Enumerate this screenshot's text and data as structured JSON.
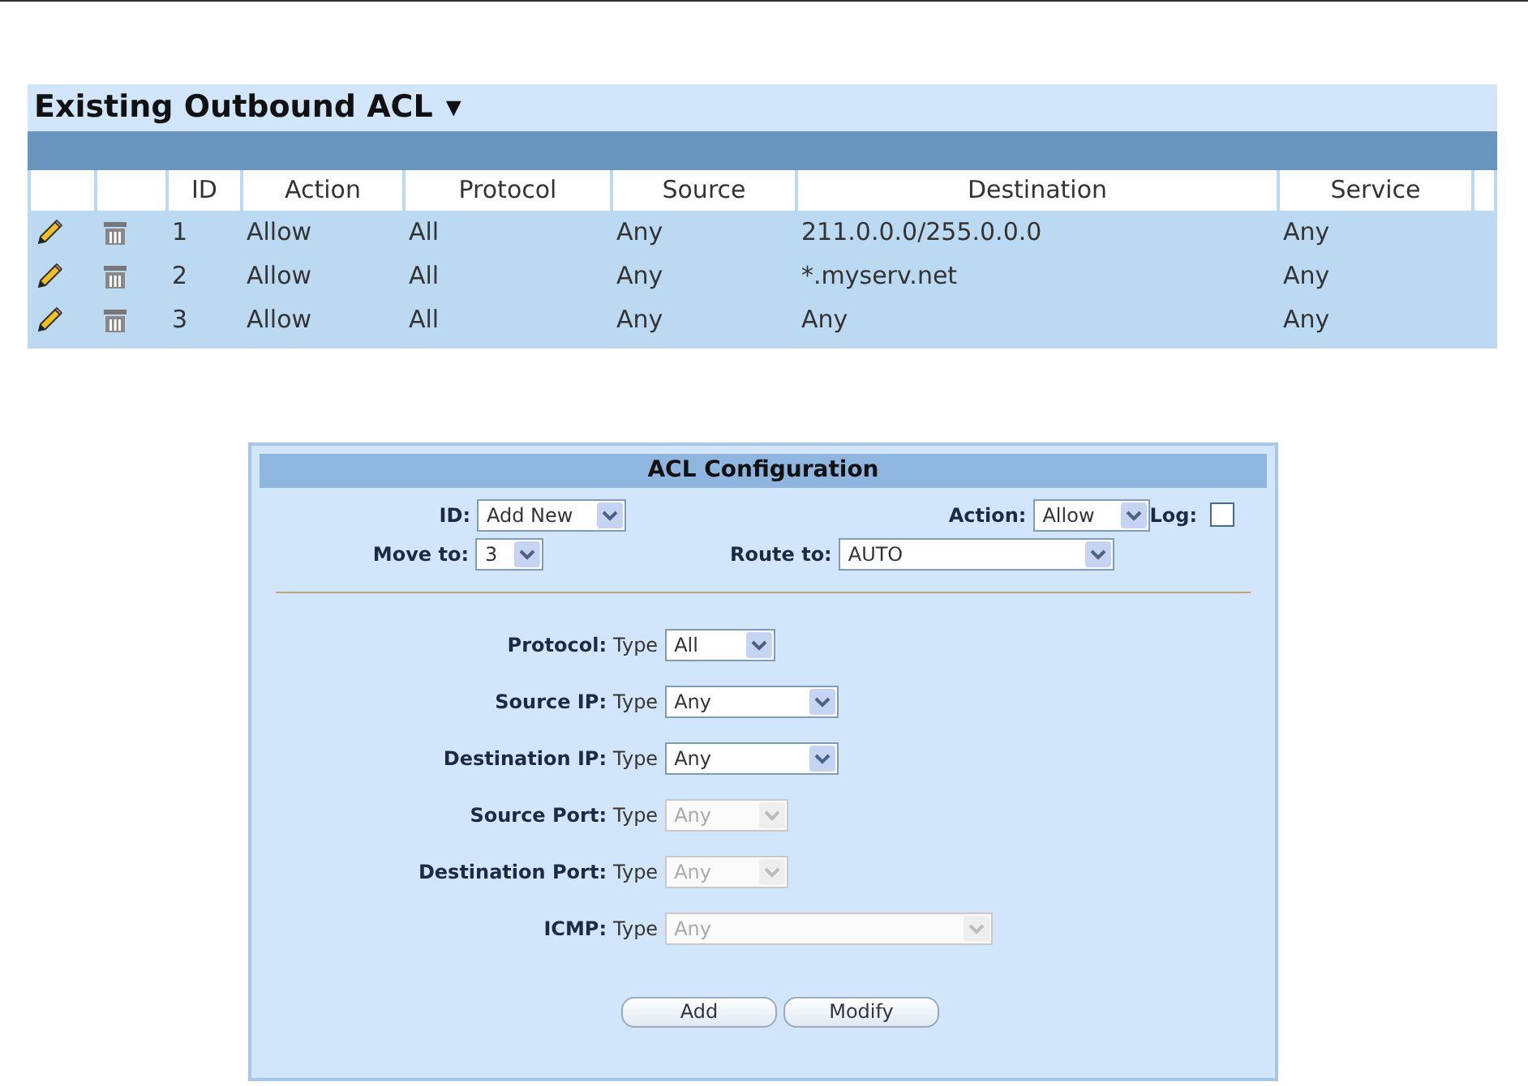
{
  "acl_list": {
    "title": "Existing Outbound ACL",
    "title_caret": "▾",
    "columns": [
      "ID",
      "Action",
      "Protocol",
      "Source",
      "Destination",
      "Service"
    ],
    "rows": [
      {
        "id": "1",
        "action": "Allow",
        "protocol": "All",
        "source": "Any",
        "destination": "211.0.0.0/255.0.0.0",
        "service": "Any"
      },
      {
        "id": "2",
        "action": "Allow",
        "protocol": "All",
        "source": "Any",
        "destination": "*.myserv.net",
        "service": "Any"
      },
      {
        "id": "3",
        "action": "Allow",
        "protocol": "All",
        "source": "Any",
        "destination": "Any",
        "service": "Any"
      }
    ]
  },
  "config": {
    "title": "ACL Configuration",
    "id_field": {
      "label": "ID:",
      "value": "Add New"
    },
    "action_field": {
      "label": "Action:",
      "value": "Allow"
    },
    "log": {
      "label": "Log:",
      "checked": false
    },
    "move_field": {
      "label": "Move to:",
      "value": "3"
    },
    "route_field": {
      "label": "Route to:",
      "value": "AUTO"
    },
    "rules": [
      {
        "label": "Protocol:",
        "type_label": "Type",
        "value": "All",
        "disabled": false
      },
      {
        "label": "Source IP:",
        "type_label": "Type",
        "value": "Any",
        "disabled": false
      },
      {
        "label": "Destination IP:",
        "type_label": "Type",
        "value": "Any",
        "disabled": false
      },
      {
        "label": "Source Port:",
        "type_label": "Type",
        "value": "Any",
        "disabled": true
      },
      {
        "label": "Destination Port:",
        "type_label": "Type",
        "value": "Any",
        "disabled": true
      },
      {
        "label": "ICMP:",
        "type_label": "Type",
        "value": "Any",
        "disabled": true
      }
    ],
    "buttons": [
      "Add",
      "Modify"
    ]
  }
}
